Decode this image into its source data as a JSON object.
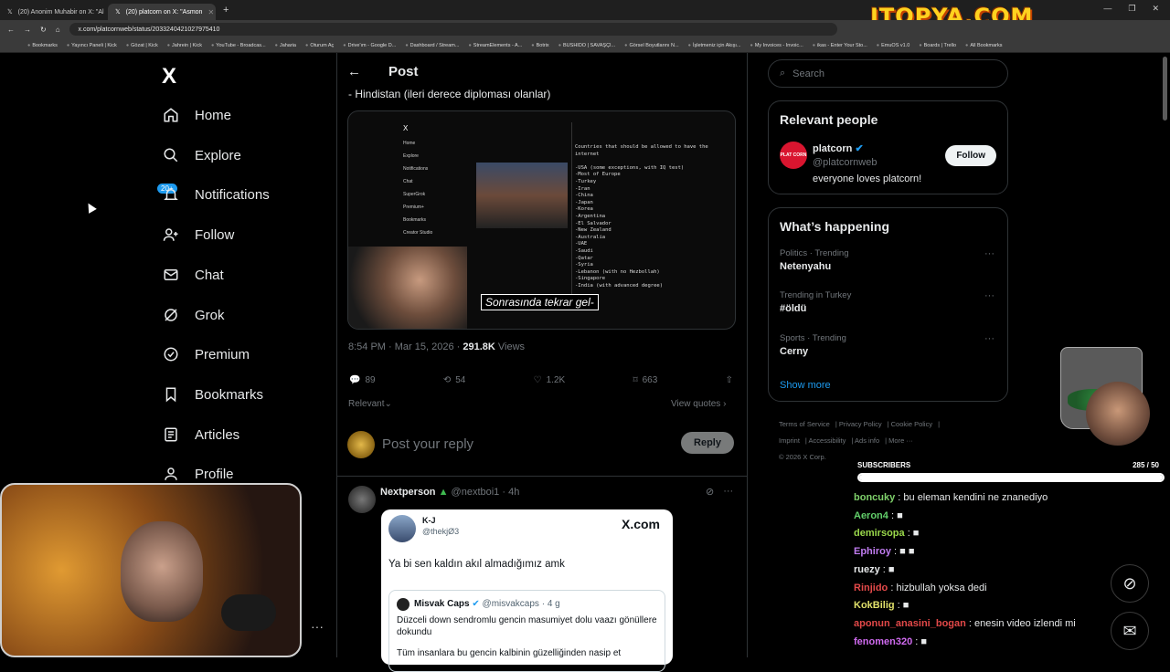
{
  "browser": {
    "tabs": [
      {
        "label": "(20) Anonim Muhabir on X: \"Al",
        "active": false
      },
      {
        "label": "(20) platcorn on X: \"Asmon",
        "active": true
      }
    ],
    "url": "x.com/platcornweb/status/2033240421027975410",
    "brand_overlay": "ITOPYA.COM",
    "bookmarks": [
      "Bookmarks",
      "Yayıncı Paneli | Kick",
      "Gözat | Kick",
      "Jahrein | Kick",
      "YouTube - Broadcas...",
      "Jaharia",
      "Oturum Aç",
      "Drive'ım - Google D...",
      "Dashboard / Stream...",
      "StreamElements - A...",
      "Botrix",
      "BUSHIDO | SAVAŞÇI...",
      "Görsel Boyutlarını N...",
      "İşletmeniz için Akışı...",
      "My Invoices - Invoic...",
      "ikas - Enter Your Sto...",
      "EmuOS v1.0",
      "Boards | Trello",
      "All Bookmarks"
    ]
  },
  "nav": {
    "logo": "X",
    "items": [
      {
        "label": "Home",
        "icon": "home-icon"
      },
      {
        "label": "Explore",
        "icon": "search-icon"
      },
      {
        "label": "Notifications",
        "icon": "bell-icon"
      },
      {
        "label": "Follow",
        "icon": "add-user-icon"
      },
      {
        "label": "Chat",
        "icon": "mail-icon"
      },
      {
        "label": "Grok",
        "icon": "grok-icon"
      },
      {
        "label": "Premium",
        "icon": "verified-icon"
      },
      {
        "label": "Bookmarks",
        "icon": "bookmark-icon"
      },
      {
        "label": "Articles",
        "icon": "article-icon"
      },
      {
        "label": "Profile",
        "icon": "person-icon"
      }
    ],
    "notif_badge": "20+"
  },
  "post": {
    "header": "Post",
    "text_tail": "- Hindistan (ileri derece diploması olanlar)",
    "media": {
      "caption": "Sonrasında tekrar gel-",
      "side_items": [
        "Home",
        "Explore",
        "Notifications",
        "Chat",
        "SuperGrok",
        "Premium+",
        "Bookmarks",
        "Creator Studio"
      ],
      "list": "Countries that should be allowed to have the\ninternet\n\n-USA (some exceptions, with IQ test)\n-Most of Europe\n-Turkey\n-Iran\n-China\n-Japan\n-Korea\n-Argentina\n-El Salvador\n-New Zealand\n-Australia\n-UAE\n-Saudi\n-Qatar\n-Syria\n-Lebanon (with no Hezbollah)\n-Singapore\n-India (with advanced degree)"
    },
    "time": "8:54 PM · Mar 15, 2026 · ",
    "views": "291.8K",
    "views_label": " Views",
    "actions": {
      "replies": "89",
      "reposts": "54",
      "likes": "1.2K",
      "bookmarks": "663"
    },
    "relevant": "Relevant",
    "view_quotes": "View quotes",
    "reply_placeholder": "Post your reply",
    "reply_button": "Reply"
  },
  "reply_tweet": {
    "name": "Nextperson",
    "handle": "@nextboi1 · 4h",
    "card": {
      "name": "K-J",
      "handle": "@thekjØ3",
      "brand": "X.com",
      "text": "Ya bi sen kaldın akıl almadığımız amk",
      "quote_name": "Misvak Caps",
      "quote_handle": "@misvakcaps · 4 g",
      "quote_text": "Düzceli down sendromlu gencin masumiyet dolu vaazı gönüllere dokundu",
      "quote_text2": "Tüm insanlara bu gencin kalbinin güzelliğinden nasip et"
    }
  },
  "sidebar": {
    "search_placeholder": "Search",
    "relevant_title": "Relevant people",
    "person": {
      "name": "platcorn",
      "handle": "@platcornweb",
      "bio": "everyone loves platcorn!",
      "follow": "Follow",
      "avatar_text": "PLAT CORN"
    },
    "happening_title": "What’s happening",
    "trends": [
      {
        "meta": "Politics · Trending",
        "name": "Netenyahu"
      },
      {
        "meta": "Trending in Turkey",
        "name": "#öldü"
      },
      {
        "meta": "Sports · Trending",
        "name": "Cerny"
      }
    ],
    "show_more": "Show more",
    "footer": [
      "Terms of Service",
      "Privacy Policy",
      "Cookie Policy",
      "Imprint",
      "Accessibility",
      "Ads info",
      "More ···",
      "© 2026 X Corp."
    ]
  },
  "stream": {
    "subs_label": "SUBSCRIBERS",
    "subs_count": "285 / 50",
    "subs_progress": 1.0,
    "chat": [
      {
        "user": "boncuky",
        "color": "#7fd16b",
        "text": "bu eleman kendini ne znanediyo"
      },
      {
        "user": "Aeron4",
        "color": "#63d06b",
        "text": "■"
      },
      {
        "user": "demirsopa",
        "color": "#9ad84b",
        "text": "■"
      },
      {
        "user": "Ephiroy",
        "color": "#c07cf0",
        "text": "■ ■"
      },
      {
        "user": "ruezy",
        "color": "#e7e9ea",
        "text": "■"
      },
      {
        "user": "Rinjido",
        "color": "#e64a4a",
        "text": "hizbullah yoksa dedi"
      },
      {
        "user": "KokBilig",
        "color": "#e0e06a",
        "text": "■"
      },
      {
        "user": "aponun_anasini_bogan",
        "color": "#e24848",
        "text": "enesin video izlendi mi"
      },
      {
        "user": "fenomen320",
        "color": "#d06bf0",
        "text": "■"
      }
    ]
  }
}
